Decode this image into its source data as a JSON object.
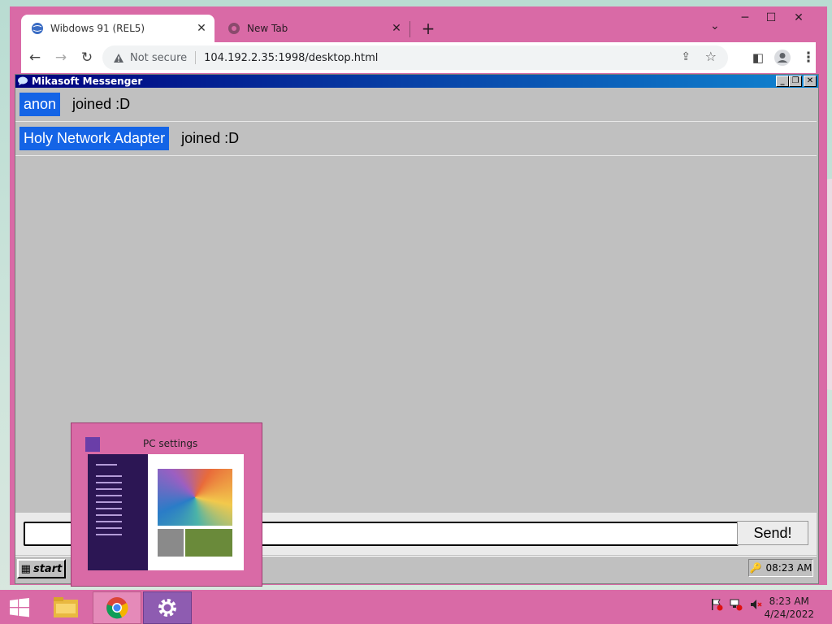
{
  "browser": {
    "tabs": [
      {
        "title": "Wibdows 91 (REL5)"
      },
      {
        "title": "New Tab"
      }
    ],
    "security_label": "Not secure",
    "url": "104.192.2.35:1998/desktop.html"
  },
  "messenger": {
    "title": "Mikasoft Messenger",
    "messages": [
      {
        "name": "anon",
        "text": "joined :D"
      },
      {
        "name": "Holy Network Adapter",
        "text": "joined :D"
      }
    ],
    "input_value": "",
    "send_label": "Send!",
    "start_label": "start",
    "tray_time": "08:23 AM"
  },
  "thumbnail": {
    "title": "PC settings"
  },
  "taskbar": {
    "time": "8:23 AM",
    "date": "4/24/2022"
  },
  "colors": {
    "accent": "#d96aa6",
    "name_bg": "#1464e6",
    "titlebar": "#00007e"
  }
}
